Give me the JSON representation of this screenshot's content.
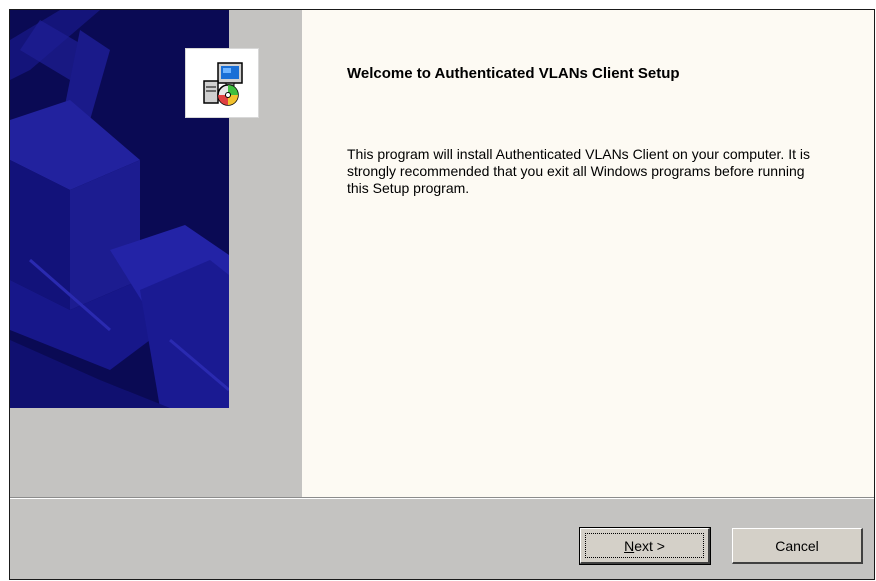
{
  "dialog": {
    "title": "Welcome to Authenticated VLANs Client Setup",
    "message": "This program will install Authenticated VLANs Client on your computer.  It is strongly recommended that you exit all Windows programs before running this Setup program.",
    "banner_icon": "setup-computer-cd-icon"
  },
  "buttons": {
    "next": {
      "label_accel": "N",
      "label_rest": "ext >"
    },
    "cancel": {
      "label": "Cancel"
    }
  },
  "colors": {
    "banner": "#0a0a54",
    "content_bg": "#fdfaf3",
    "chrome": "#c4c3c1"
  }
}
